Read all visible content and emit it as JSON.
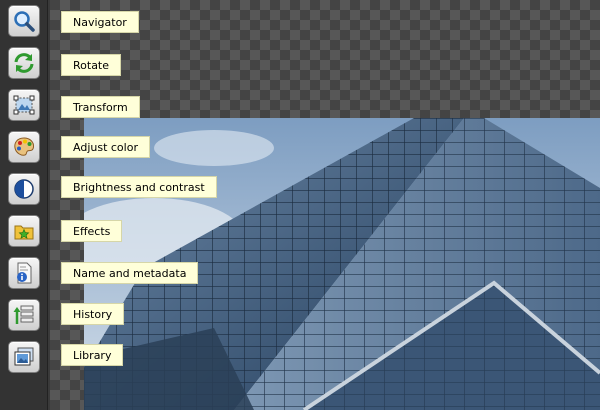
{
  "tools": [
    {
      "label": "Navigator",
      "icon": "magnifier-icon"
    },
    {
      "label": "Rotate",
      "icon": "rotate-arrows-icon"
    },
    {
      "label": "Transform",
      "icon": "transform-frame-icon"
    },
    {
      "label": "Adjust color",
      "icon": "color-palette-icon"
    },
    {
      "label": "Brightness and contrast",
      "icon": "contrast-circle-icon"
    },
    {
      "label": "Effects",
      "icon": "star-folder-icon"
    },
    {
      "label": "Name and metadata",
      "icon": "info-document-icon"
    },
    {
      "label": "History",
      "icon": "history-list-icon"
    },
    {
      "label": "Library",
      "icon": "picture-library-icon"
    }
  ],
  "colors": {
    "tooltip_bg": "#ffffd9",
    "toolbar_bg": "#333333",
    "checker_dark": "#444444",
    "checker_light": "#575757"
  }
}
